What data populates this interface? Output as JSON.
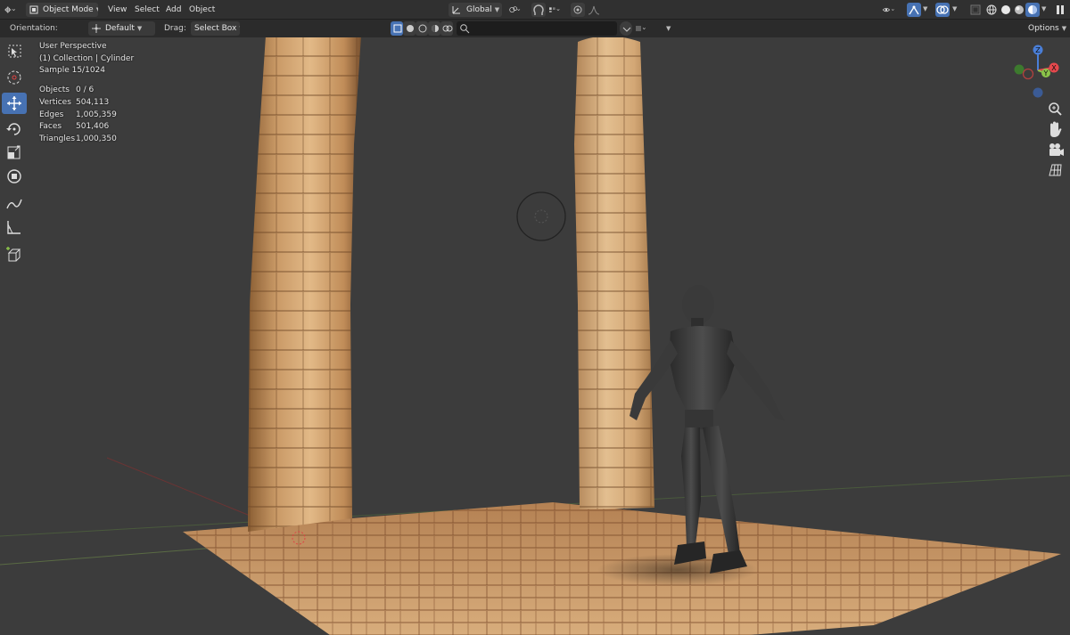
{
  "header": {
    "mode": "Object Mode",
    "menus": [
      "View",
      "Select",
      "Add",
      "Object"
    ],
    "transform_orientation": "Global"
  },
  "toolbar": {
    "orientation_label": "Orientation:",
    "orientation_value": "Default",
    "drag_label": "Drag:",
    "drag_value": "Select Box",
    "search_placeholder": "",
    "options_label": "Options"
  },
  "overlay": {
    "perspective": "User Perspective",
    "collection": "(1) Collection | Cylinder",
    "sample": "Sample 15/1024",
    "stats": [
      {
        "label": "Objects",
        "value": "0 / 6"
      },
      {
        "label": "Vertices",
        "value": "504,113"
      },
      {
        "label": "Edges",
        "value": "1,005,359"
      },
      {
        "label": "Faces",
        "value": "501,406"
      },
      {
        "label": "Triangles",
        "value": "1,000,350"
      }
    ]
  },
  "gizmo": {
    "x": "X",
    "y": "Y",
    "z": "Z"
  },
  "colors": {
    "header_bg": "#303030",
    "toolbar_bg": "#2b2b2b",
    "viewport_bg": "#3c3c3c",
    "active_tool": "#4772b3",
    "axis_x": "#e5484d",
    "axis_y": "#8bc34a",
    "axis_z": "#4a7fd8"
  },
  "icons": {
    "editor_type": "editor-type-icon",
    "mode": "object-mode-icon",
    "tools": [
      "select-box-icon",
      "cursor-icon",
      "move-icon",
      "rotate-icon",
      "scale-icon",
      "transform-icon",
      "annotate-icon",
      "measure-icon",
      "add-cube-icon"
    ],
    "navigation": [
      "zoom-icon",
      "pan-hand-icon",
      "camera-icon",
      "grid-icon"
    ]
  }
}
